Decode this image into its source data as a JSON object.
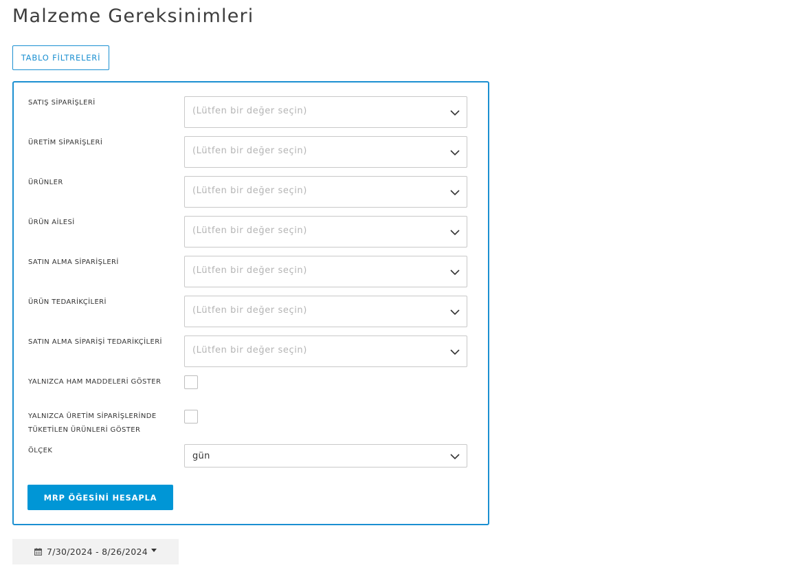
{
  "page": {
    "title": "Malzeme Gereksinimleri"
  },
  "filters_toggle": {
    "label": "TABLO FİLTRELERİ"
  },
  "filters": {
    "rows": [
      {
        "label": "SATIŞ SİPARİŞLERİ",
        "placeholder": "(Lütfen bir değer seçin)"
      },
      {
        "label": "ÜRETİM SİPARİŞLERİ",
        "placeholder": "(Lütfen bir değer seçin)"
      },
      {
        "label": "ÜRÜNLER",
        "placeholder": "(Lütfen bir değer seçin)"
      },
      {
        "label": "ÜRÜN AİLESİ",
        "placeholder": "(Lütfen bir değer seçin)"
      },
      {
        "label": "SATIN ALMA SİPARİŞLERİ",
        "placeholder": "(Lütfen bir değer seçin)"
      },
      {
        "label": "ÜRÜN TEDARİKÇİLERİ",
        "placeholder": "(Lütfen bir değer seçin)"
      },
      {
        "label": "SATIN ALMA SİPARİŞİ TEDARİKÇİLERİ",
        "placeholder": "(Lütfen bir değer seçin)"
      }
    ],
    "raw_materials_only": {
      "label": "YALNIZCA HAM MADDELERİ GÖSTER",
      "checked": false
    },
    "consumed_in_production_only": {
      "label_line1": "YALNIZCA ÜRETİM SİPARİŞLERİNDE",
      "label_line2": "TÜKETİLEN ÜRÜNLERİ GÖSTER",
      "checked": false
    },
    "scale": {
      "label": "ÖLÇEK",
      "value": "gün"
    },
    "calculate_button": "MRP ÖĞESİNİ HESAPLA"
  },
  "date_range": {
    "icon": "calendar-icon",
    "text": "7/30/2024 - 8/26/2024"
  },
  "colors": {
    "accent": "#1a8fd1",
    "primary_button": "#0096d6"
  }
}
